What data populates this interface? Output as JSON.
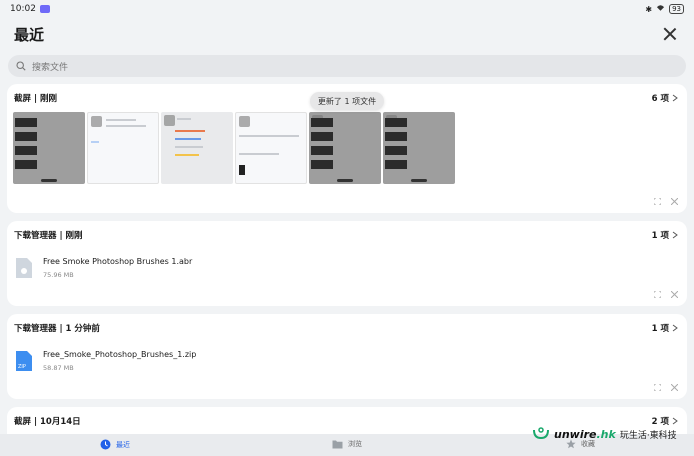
{
  "status": {
    "time": "10:02",
    "battery": "93"
  },
  "header": {
    "title": "最近"
  },
  "search": {
    "placeholder": "搜索文件"
  },
  "toast": "更新了 1 项文件",
  "cards": [
    {
      "title": "截屏 | 刚刚",
      "count": "6 项"
    },
    {
      "title": "下载管理器 | 刚刚",
      "count": "1 项",
      "file_name": "Free Smoke Photoshop Brushes 1.abr",
      "file_size": "75.96 MB"
    },
    {
      "title": "下载管理器 | 1 分钟前",
      "count": "1 项",
      "file_name": "Free_Smoke_Photoshop_Brushes_1.zip",
      "file_size": "58.87 MB",
      "file_badge": "ZIP"
    },
    {
      "title": "截屏 | 10月14日",
      "count": "2 项"
    }
  ],
  "nav": [
    {
      "label": "最近"
    },
    {
      "label": "浏览"
    },
    {
      "label": "收藏"
    }
  ],
  "watermark": {
    "brand": "unwire",
    "suffix": ".hk",
    "tagline": "玩生活·東科技"
  },
  "colors": {
    "accent": "#2060e8",
    "zip": "#3d8ef0",
    "card_bg": "#ffffff",
    "page_bg": "#f1f3f5"
  }
}
